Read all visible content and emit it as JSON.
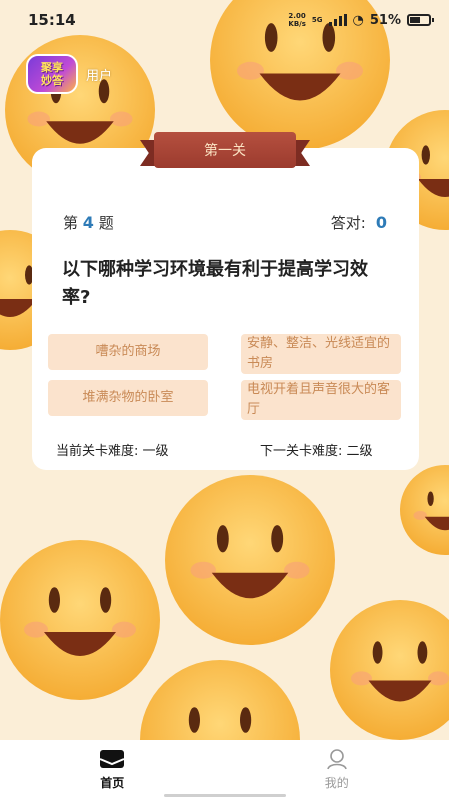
{
  "status_bar": {
    "time": "15:14",
    "net_top": "2.00",
    "net_bottom": "KB/s",
    "network_type": "5G",
    "battery": "51%"
  },
  "header": {
    "logo_text_1": "聚享",
    "logo_text_2": "妙答",
    "user_label": "用户"
  },
  "level": {
    "title": "第一关"
  },
  "quiz": {
    "question_prefix": "第",
    "question_number": "4",
    "question_suffix": "题",
    "score_label": "答对:",
    "score_value": "0",
    "question_text": "以下哪种学习环境最有利于提高学习效率?",
    "options": [
      "嘈杂的商场",
      "安静、整洁、光线适宜的书房",
      "堆满杂物的卧室",
      "电视开着且声音很大的客厅"
    ],
    "current_difficulty": "当前关卡难度: 一级",
    "next_difficulty": "下一关卡难度: 二级"
  },
  "tabs": [
    {
      "label": "首页",
      "icon": "home-icon",
      "active": true
    },
    {
      "label": "我的",
      "icon": "profile-icon",
      "active": false
    }
  ],
  "colors": {
    "background": "#fbeed7",
    "smiley": "#f7b744",
    "ribbon": "#a8473a",
    "option_bg": "#fbe3cd",
    "option_text": "#c98a56",
    "accent_number": "#2e7bb7"
  }
}
